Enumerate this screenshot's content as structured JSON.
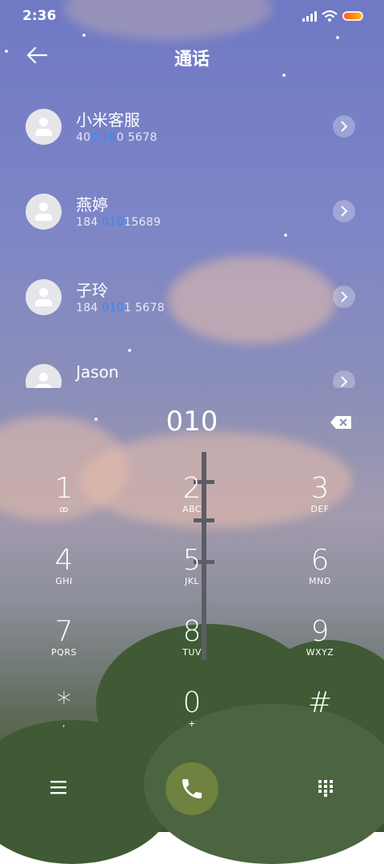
{
  "status_bar": {
    "time": "2:36"
  },
  "header": {
    "title": "通话"
  },
  "contacts": [
    {
      "name": "小米客服",
      "number_pre": "40",
      "number_match": "0 10",
      "number_post": "0 5678"
    },
    {
      "name": "燕婷",
      "number_pre": "184 ",
      "number_match": "010",
      "number_post": "15689"
    },
    {
      "name": "子玲",
      "number_pre": "184 ",
      "number_match": "010",
      "number_post": "1 5678"
    },
    {
      "name": "Jason",
      "number_pre": "",
      "number_match": "",
      "number_post": ""
    }
  ],
  "dialer": {
    "input": "010",
    "keys": [
      {
        "digit": "1",
        "letters": "ꝏ"
      },
      {
        "digit": "2",
        "letters": "ABC"
      },
      {
        "digit": "3",
        "letters": "DEF"
      },
      {
        "digit": "4",
        "letters": "GHI"
      },
      {
        "digit": "5",
        "letters": "JKL"
      },
      {
        "digit": "6",
        "letters": "MNO"
      },
      {
        "digit": "7",
        "letters": "PQRS"
      },
      {
        "digit": "8",
        "letters": "TUV"
      },
      {
        "digit": "9",
        "letters": "WXYZ"
      },
      {
        "digit": "*",
        "letters": ","
      },
      {
        "digit": "0",
        "letters": "+"
      },
      {
        "digit": "#",
        "letters": ""
      }
    ]
  },
  "colors": {
    "highlight": "#2f8cff",
    "call_button": "#6f8240"
  },
  "icons": {
    "back": "arrow-left-icon",
    "chevron": "chevron-right-icon",
    "backspace": "backspace-icon",
    "menu": "menu-icon",
    "call": "phone-icon",
    "keypad": "keypad-icon"
  }
}
